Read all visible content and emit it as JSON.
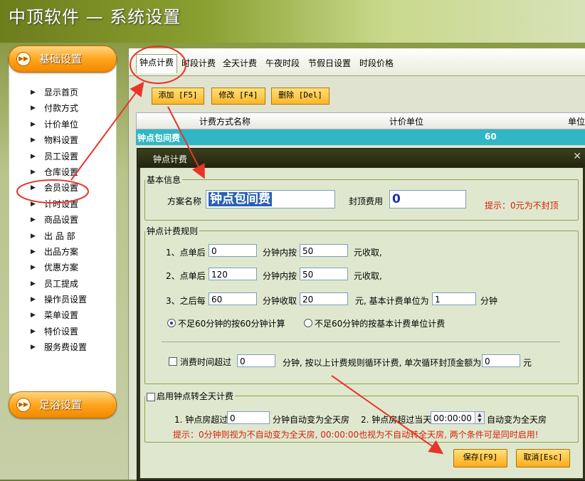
{
  "window": {
    "title": "中顶软件 — 系统设置"
  },
  "sidebar": {
    "section_basic": "基础设置",
    "section_foot": "足浴设置",
    "items": [
      "显示首页",
      "付款方式",
      "计价单位",
      "物料设置",
      "员工设置",
      "仓库设置",
      "会员设置",
      "计时设置",
      "商品设置",
      "出 品 部",
      "出品方案",
      "优惠方案",
      "员工提成",
      "操作员设置",
      "菜单设置",
      "特价设置",
      "服务费设置"
    ]
  },
  "tabs": [
    "钟点计费",
    "时段计费",
    "全天计费",
    "午夜时段",
    "节假日设置",
    "时段价格"
  ],
  "toolbar": {
    "add": "添加 [F5]",
    "edit": "修改 [F4]",
    "delete": "删除 [Del]"
  },
  "grid": {
    "columns": [
      "计费方式名称",
      "计价单位",
      "单位"
    ],
    "rows": [
      {
        "name": "钟点包间费",
        "unit": "60"
      }
    ]
  },
  "dialog": {
    "title": "钟点计费",
    "basic": {
      "legend": "基本信息",
      "plan_name_label": "方案名称",
      "plan_name": "钟点包间费",
      "cap_label": "封顶费用",
      "cap_value": "0",
      "hint": "提示：0元为不封顶"
    },
    "rules": {
      "legend": "钟点计费规则",
      "r1_label": "1、点单后",
      "r1_a": "0",
      "r1_mid": "分钟内按",
      "r1_b": "50",
      "r1_end": "元收取,",
      "r2_label": "2、点单后",
      "r2_a": "120",
      "r2_mid": "分钟内按",
      "r2_b": "50",
      "r2_end": "元收取,",
      "r3_label": "3、之后每",
      "r3_a": "60",
      "r3_mid": "分钟收取",
      "r3_b": "20",
      "r3_end": "元, 基本计费单位为",
      "r3_c": "1",
      "r3_unit": "分钟",
      "radio1": "不足60分钟的按60分钟计算",
      "radio2": "不足60分钟的按基本计费单位计费",
      "cycle_label": "消费时间超过",
      "cycle_value": "0",
      "cycle_mid": "分钟, 按以上计费规则循环计费, 单次循环封顶金额为",
      "cycle_cap": "0",
      "cycle_end": "元"
    },
    "fullday": {
      "legend": "启用钟点转全天计费",
      "c1_label": "1. 钟点房超过",
      "c1_value": "0",
      "c1_end": "分钟自动变为全天房",
      "c2_label": "2. 钟点房超过当天",
      "c2_value": "00:00:00",
      "c2_end": "自动变为全天房",
      "hint": "提示：0分钟则视为不自动变为全天房, 00:00:00也视为不自动转全天房, 两个条件可是同时启用!"
    },
    "save": "保存[F9]",
    "cancel": "取消[Esc]"
  },
  "colors": {
    "accent_orange": "#ffa51e",
    "selection_teal": "#30b6c4",
    "hint_red": "#d81e06",
    "annotation_red": "#e8352a"
  }
}
